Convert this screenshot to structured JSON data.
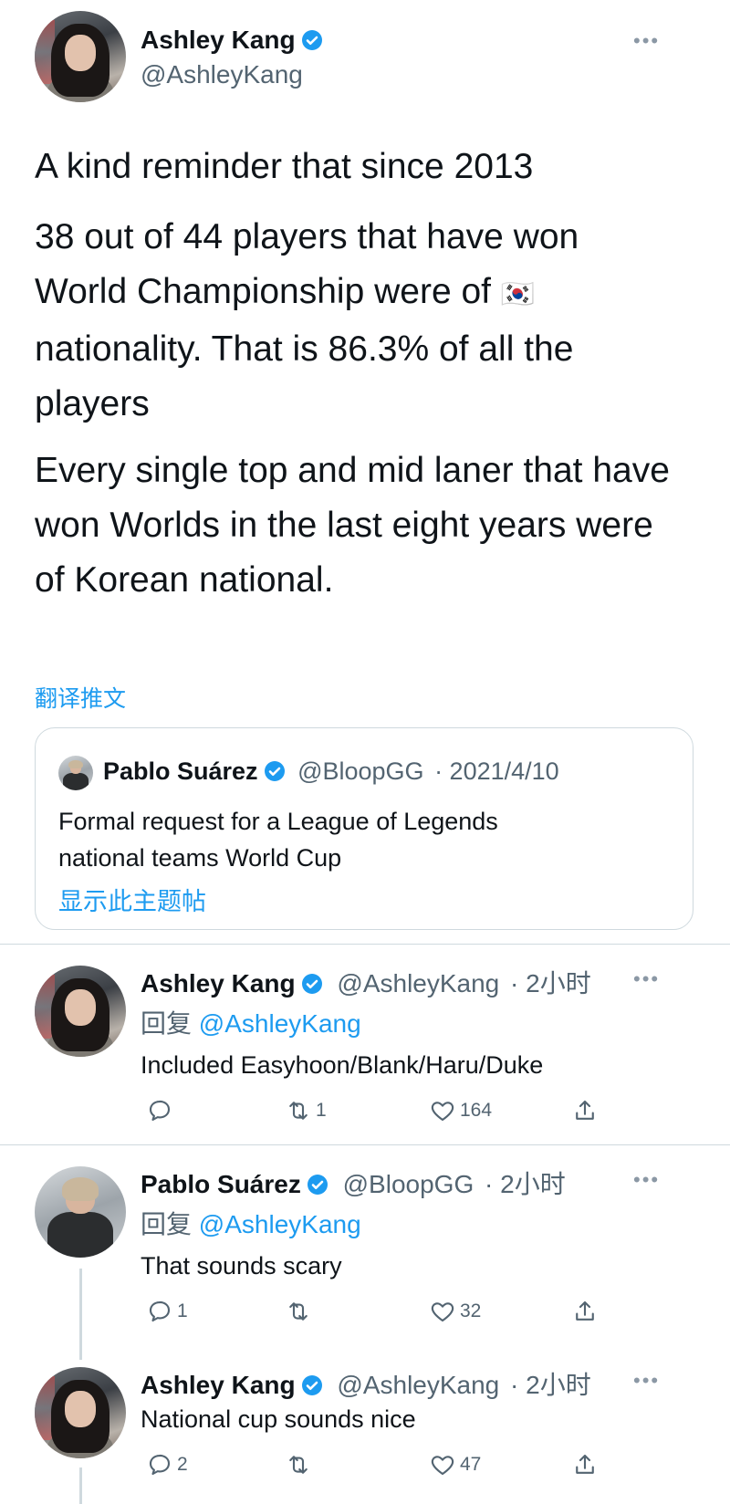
{
  "main_tweet": {
    "author_name": "Ashley Kang",
    "author_handle": "@AshleyKang",
    "paragraphs": [
      "A kind reminder that since 2013",
      "38 out of 44 players that have won World Championship were of",
      "nationality. That is 86.3% of all the players",
      "Every single top and mid laner that have won Worlds in the last eight years were of Korean national."
    ],
    "flag_emoji": "🇰🇷",
    "translate_label": "翻译推文"
  },
  "quote_tweet": {
    "author_name": "Pablo Suárez",
    "author_handle": "@BloopGG",
    "date": "· 2021/4/10",
    "text_lines": [
      "Formal request for a League of Legends",
      "national teams World Cup"
    ],
    "show_thread_label": "显示此主题帖"
  },
  "replies": [
    {
      "author_name": "Ashley Kang",
      "author_handle": "@AshleyKang",
      "time": "· 2小时",
      "reply_prefix": "回复",
      "reply_to": "@AshleyKang",
      "text": "Included Easyhoon/Blank/Haru/Duke",
      "reply_count": "",
      "retweet_count": "1",
      "like_count": "164"
    },
    {
      "author_name": "Pablo Suárez",
      "author_handle": "@BloopGG",
      "time": "· 2小时",
      "reply_prefix": "回复",
      "reply_to": "@AshleyKang",
      "text": "That sounds scary",
      "reply_count": "1",
      "retweet_count": "",
      "like_count": "32"
    },
    {
      "author_name": "Ashley Kang",
      "author_handle": "@AshleyKang",
      "time": "· 2小时",
      "text": "National cup sounds nice",
      "reply_count": "2",
      "retweet_count": "",
      "like_count": "47"
    }
  ],
  "colors": {
    "accent": "#1d9bf0",
    "muted": "#536471",
    "border": "#cfd9de"
  },
  "icons": {
    "more": "more-horizontal-icon",
    "verified": "verified-badge-icon",
    "reply": "reply-icon",
    "retweet": "retweet-icon",
    "like": "heart-icon",
    "share": "share-icon"
  }
}
